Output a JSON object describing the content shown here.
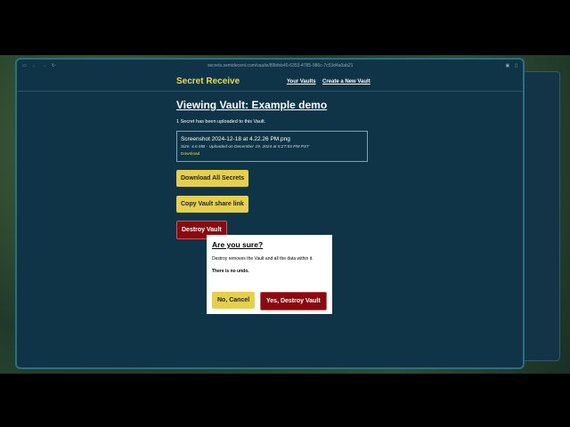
{
  "browser": {
    "url": "secrets.semidecent.com/vaults/89bfeb40-6353-4785-986c-7c53d4a0ab21"
  },
  "nav": {
    "brand": "Secret Receive",
    "your_vaults": "Your Vaults",
    "create_vault": "Create a New Vault"
  },
  "main": {
    "title": "Viewing Vault: Example demo",
    "note": "1 Secret has been uploaded to this Vault.",
    "file": {
      "name": "Screenshot 2024-12-18 at 4.22.26 PM.png",
      "size": "Size: 4.6 MB",
      "uploaded": "Uploaded on December 19, 2024 at 5:27:53 PM PST",
      "download": "Download"
    },
    "download_all": "Download All Secrets",
    "copy_link": "Copy Vault share link",
    "destroy": "Destroy Vault"
  },
  "popover": {
    "title": "Are you sure?",
    "body": "Destroy removes the Vault and all the data within it.",
    "warning": "There is no undo.",
    "cancel": "No, Cancel",
    "confirm": "Yes, Destroy Vault"
  }
}
